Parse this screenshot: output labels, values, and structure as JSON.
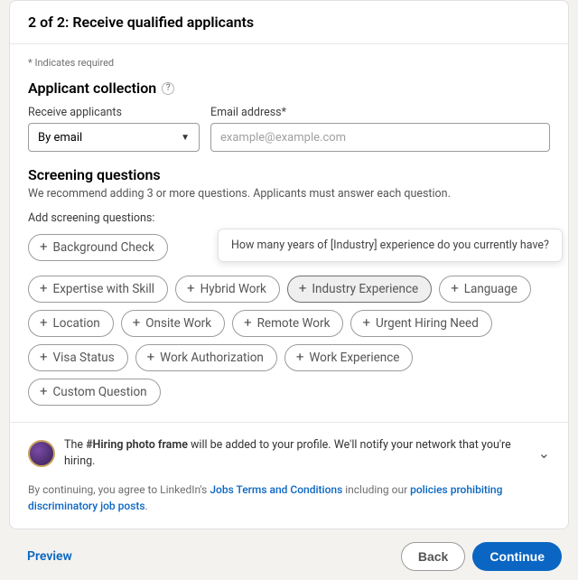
{
  "header": {
    "step_text": "2 of 2: Receive qualified applicants"
  },
  "body": {
    "required_hint": "* Indicates required",
    "applicant_collection": {
      "title": "Applicant collection",
      "receive_label": "Receive applicants",
      "receive_value": "By email",
      "email_label": "Email address*",
      "email_placeholder": "example@example.com"
    },
    "screening": {
      "title": "Screening questions",
      "subtitle": "We recommend adding 3 or more questions. Applicants must answer each question.",
      "add_label": "Add screening questions:",
      "pills": [
        "Background Check",
        "",
        "Expertise with Skill",
        "Hybrid Work",
        "Industry Experience",
        "Language",
        "Location",
        "Onsite Work",
        "Remote Work",
        "Urgent Hiring Need",
        "Visa Status",
        "Work Authorization",
        "Work Experience",
        "Custom Question"
      ],
      "tooltip": "How many years of [Industry] experience do you currently have?"
    }
  },
  "footer": {
    "frame_strong": "#Hiring photo frame",
    "frame_rest": " will be added to your profile. We'll notify your network that you're hiring.",
    "legal_prefix": "By continuing, you agree to LinkedIn's ",
    "legal_link1": "Jobs Terms and Conditions",
    "legal_mid": " including our ",
    "legal_link2": "policies prohibiting discriminatory job posts",
    "legal_suffix": "."
  },
  "actions": {
    "preview": "Preview",
    "back": "Back",
    "continue": "Continue"
  }
}
